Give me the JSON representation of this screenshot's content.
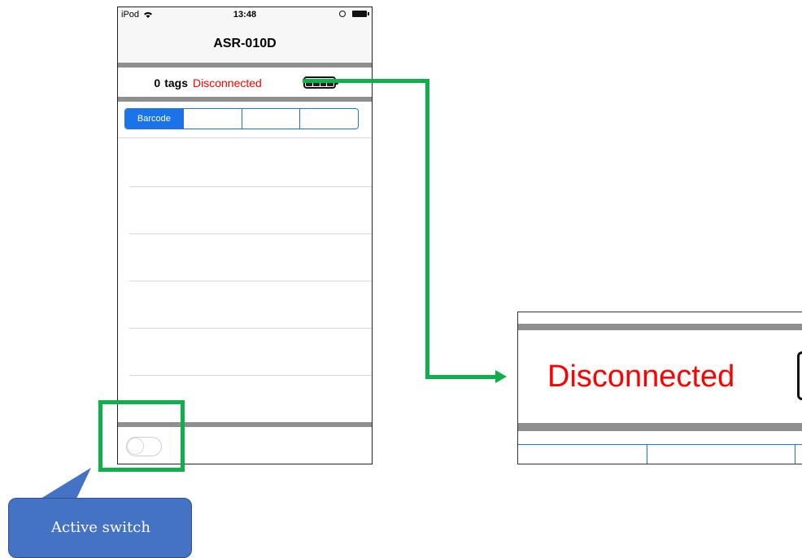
{
  "status_bar": {
    "carrier": "iPod",
    "time": "13:48"
  },
  "nav": {
    "title": "ASR-010D",
    "left_label": "",
    "right_label": ""
  },
  "info": {
    "tag_count": "0",
    "tag_unit": "tags",
    "connection_status": "Disconnected",
    "battery_level": "4 of 4 bars"
  },
  "segments": [
    {
      "label": "Barcode",
      "active": true
    },
    {
      "label": "",
      "active": false
    },
    {
      "label": "",
      "active": false
    },
    {
      "label": "",
      "active": false
    }
  ],
  "toolbar": {
    "active_switch_on": false
  },
  "zoom": {
    "connection_status": "Disconnected"
  },
  "callout": {
    "text": "Active switch"
  },
  "colors": {
    "accent": "#1a73e8",
    "status_red": "#ff0000",
    "annotation_green": "#0fb04b",
    "callout_blue": "#4472c4"
  }
}
